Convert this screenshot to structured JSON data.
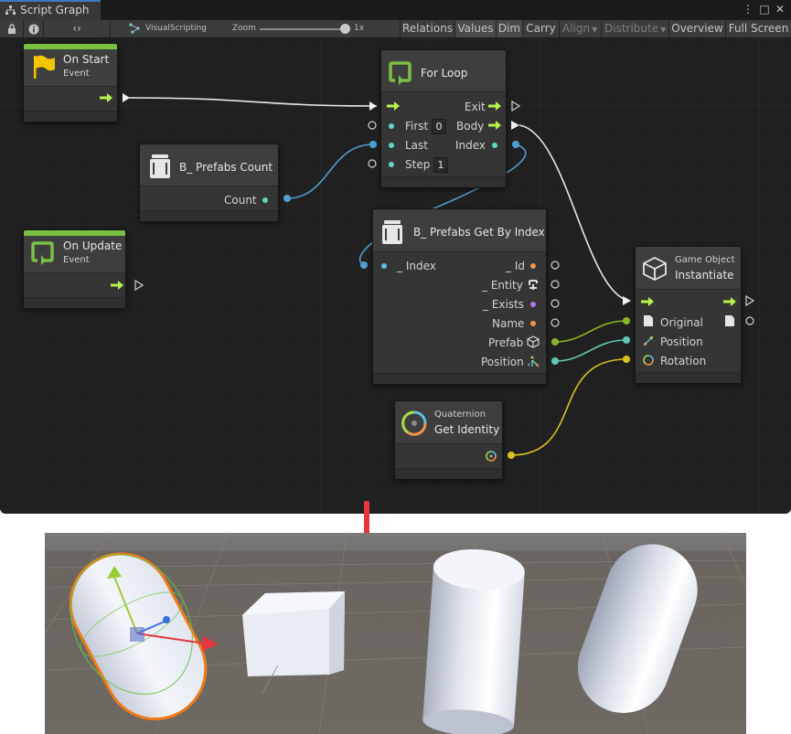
{
  "window": {
    "tab_title": "Script Graph"
  },
  "toolbar": {
    "code_label": "‹›",
    "breadcrumb": "VisualScripting",
    "zoom_label": "Zoom",
    "zoom_value": "1x",
    "buttons": [
      "Relations",
      "Values",
      "Dim",
      "Carry",
      "Align",
      "Distribute",
      "Overview",
      "Full Screen"
    ]
  },
  "nodes": {
    "on_start": {
      "title": "On Start",
      "subtitle": "Event"
    },
    "on_update": {
      "title": "On Update",
      "subtitle": "Event"
    },
    "for_loop": {
      "title": "For Loop",
      "exit": "Exit",
      "first": "First",
      "first_value": "0",
      "body": "Body",
      "last": "Last",
      "index": "Index",
      "step": "Step",
      "step_value": "1"
    },
    "prefabs_count": {
      "title": "B_ Prefabs Count",
      "output": "Count"
    },
    "get_by_index": {
      "title": "B_ Prefabs Get By Index",
      "input": "_ Index",
      "outputs": [
        "_ Id",
        "_ Entity",
        "_ Exists",
        "Name",
        "Prefab",
        "Position"
      ]
    },
    "instantiate": {
      "category": "Game Object",
      "title": "Instantiate",
      "inputs": [
        "Original",
        "Position",
        "Rotation"
      ]
    },
    "get_identity": {
      "category": "Quaternion",
      "title": "Get Identity"
    }
  },
  "colors": {
    "editor_bg": "#202020",
    "event_green": "#7ac143",
    "flow_arrow": "#b5f54b",
    "float_port": "#5dc1e6",
    "int_port": "#5dd8c4",
    "string_port": "#f0934b",
    "bool_port": "#b07be6",
    "object_port": "#92c02f",
    "vector_port": "#6fd3c0",
    "quaternion_port": "#e6cf2a",
    "arrow_red": "#e8363c",
    "selection_orange": "#f07a16"
  }
}
